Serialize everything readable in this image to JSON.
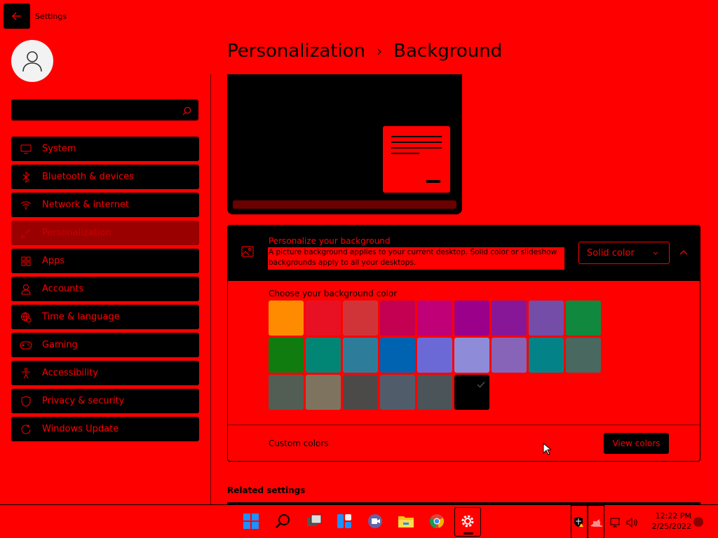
{
  "window": {
    "title": "Settings"
  },
  "search": {
    "placeholder": ""
  },
  "nav": {
    "items": [
      {
        "label": "System",
        "icon": "monitor-icon"
      },
      {
        "label": "Bluetooth & devices",
        "icon": "bluetooth-icon"
      },
      {
        "label": "Network & internet",
        "icon": "wifi-icon"
      },
      {
        "label": "Personalization",
        "icon": "brush-icon",
        "selected": true
      },
      {
        "label": "Apps",
        "icon": "apps-grid-icon"
      },
      {
        "label": "Accounts",
        "icon": "person-icon"
      },
      {
        "label": "Time & language",
        "icon": "globe-clock-icon"
      },
      {
        "label": "Gaming",
        "icon": "gamepad-icon"
      },
      {
        "label": "Accessibility",
        "icon": "accessibility-icon"
      },
      {
        "label": "Privacy & security",
        "icon": "shield-icon"
      },
      {
        "label": "Windows Update",
        "icon": "update-icon"
      }
    ]
  },
  "page": {
    "breadcrumb_parent": "Personalization",
    "breadcrumb_separator": "›",
    "breadcrumb_current": "Background"
  },
  "background_card": {
    "title": "Personalize your background",
    "description": "A picture background applies to your current desktop. Solid color or slideshow backgrounds apply to all your desktops.",
    "dropdown_value": "Solid color",
    "choose_label": "Choose your background color",
    "custom_colors_label": "Custom colors",
    "view_colors_button": "View colors"
  },
  "swatch_colors": [
    "#ff8c00",
    "#e81123",
    "#d13438",
    "#c30052",
    "#bf0077",
    "#9a0089",
    "#881798",
    "#744da9",
    "#10893e",
    "#107c10",
    "#018574",
    "#2d7d9a",
    "#0063b1",
    "#6b69d6",
    "#8e8cd8",
    "#8764b8",
    "#038387",
    "#486860",
    "#525e54",
    "#7e735f",
    "#4c4a48",
    "#515c6b",
    "#4a5459",
    "#000000"
  ],
  "selected_swatch_index": 23,
  "related_settings_label": "Related settings",
  "taskbar": {
    "time": "12:22 PM",
    "date": "2/25/2022",
    "apps": [
      "windows-start-icon",
      "search-icon",
      "task-view-icon",
      "widgets-icon",
      "teams-chat-icon",
      "file-explorer-icon",
      "chrome-icon",
      "settings-gear-icon"
    ]
  },
  "colors": {
    "background": "#ff0000",
    "surface": "#000000",
    "selected_nav": "#9a0000"
  }
}
